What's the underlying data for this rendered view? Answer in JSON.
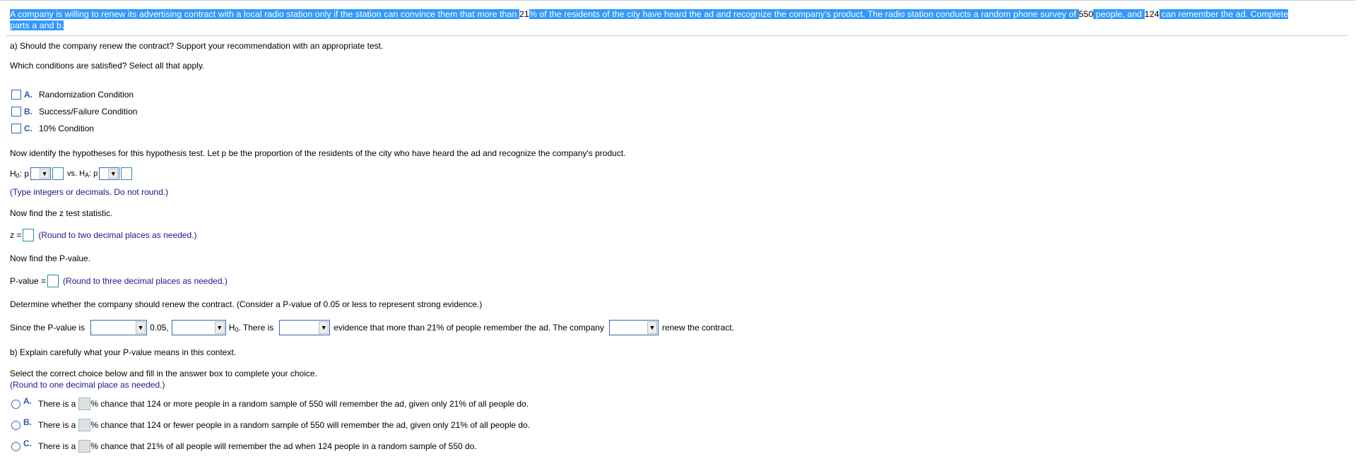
{
  "intro": {
    "parts": [
      {
        "text": "A company is willing to renew its advertising contract with a local radio station only if the station can convince them that more than ",
        "hl": true
      },
      {
        "text": "21",
        "hl": false
      },
      {
        "text": "% of the residents of the city have heard the ad and recognize the company's product. The radio station conducts a random phone survey of ",
        "hl": true
      },
      {
        "text": "550",
        "hl": false
      },
      {
        "text": " people, and ",
        "hl": true
      },
      {
        "text": "124",
        "hl": false
      },
      {
        "text": " can remember the ad. Complete ",
        "hl": true
      }
    ],
    "line2": "parts a and b."
  },
  "part_a": {
    "question": "a) Should the company renew the contract? Support your recommendation with an appropriate test.",
    "conditions_prompt": "Which conditions are satisfied? Select all that apply.",
    "conditions": [
      {
        "letter": "A.",
        "label": "Randomization Condition",
        "checked": false
      },
      {
        "letter": "B.",
        "label": "Success/Failure Condition",
        "checked": false
      },
      {
        "letter": "C.",
        "label": "10% Condition",
        "checked": false
      }
    ],
    "hyp_prompt": "Now identify the hypotheses for this hypothesis test. Let p be the proportion of the residents of the city who have heard the ad and recognize the company's product.",
    "h0_label": "H",
    "h0_sub": "0",
    "h_p": ": p",
    "vs_label": "vs. H",
    "ha_sub": "A",
    "hyp_hint": "(Type integers or decimals. Do not round.)",
    "z_prompt": "Now find the z test statistic.",
    "z_label": "z =",
    "z_hint": "(Round to two decimal places as needed.)",
    "p_prompt": "Now find the P-value.",
    "p_label": "P-value =",
    "p_hint": "(Round to three decimal places as needed.)",
    "decide_prompt": "Determine whether the company should renew the contract. (Consider a P-value of 0.05 or less to represent strong evidence.)",
    "since": "Since the P-value is",
    "alpha": "0.05,",
    "h0_text": "H",
    "h0_text_sub": "0",
    "there_is": ". There is",
    "evidence": "evidence that more than 21% of people remember the ad. The company",
    "renew": "renew the contract.",
    "dropdown_arrow": "▼"
  },
  "part_b": {
    "question": "b) Explain carefully what your P-value means in this context.",
    "prompt": "Select the correct choice below and fill in the answer box to complete your choice.",
    "hint": "(Round to one decimal place as needed.)",
    "choices": [
      {
        "letter": "A.",
        "pre": "There is a",
        "post": "% chance that 124 or more people in a random sample of 550 will remember the ad, given only 21% of all people do."
      },
      {
        "letter": "B.",
        "pre": "There is a",
        "post": "% chance that 124 or fewer people in a random sample of 550 will remember the ad, given only 21% of all people do."
      },
      {
        "letter": "C.",
        "pre": "There is a",
        "post": "% chance that 21% of all people will remember the ad when 124 people in a random sample of 550 do."
      }
    ]
  }
}
